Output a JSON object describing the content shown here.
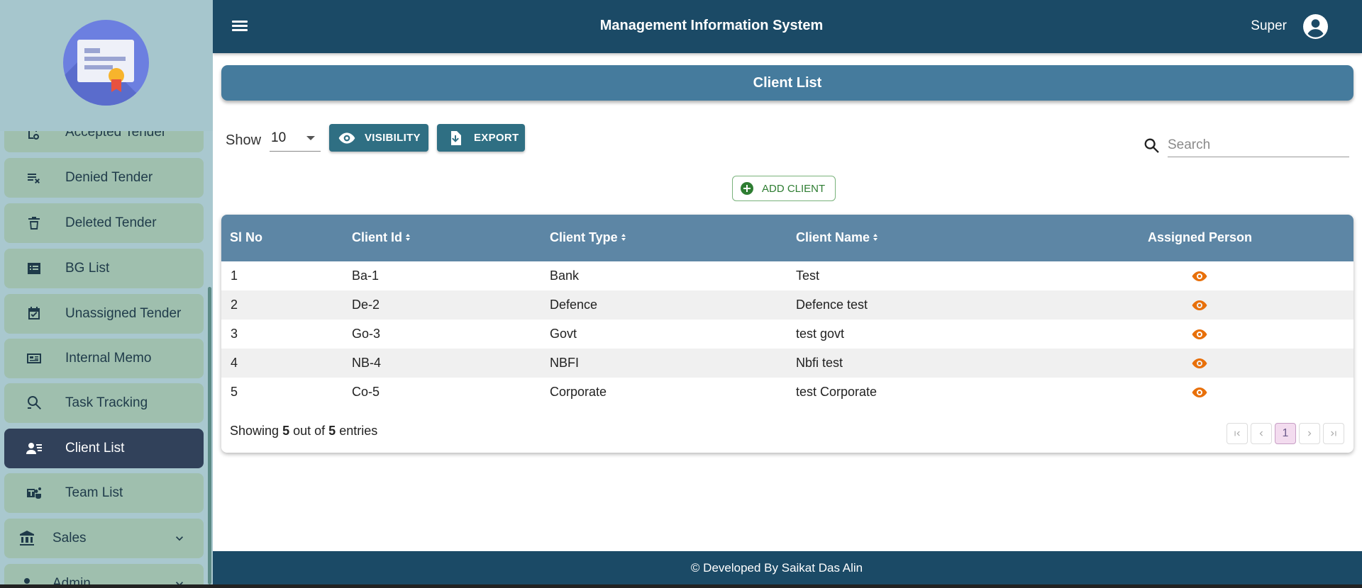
{
  "header": {
    "title": "Management Information System",
    "user_name": "Super"
  },
  "sidebar": {
    "items": [
      {
        "label": "Accepted Tender",
        "icon": "tender-accepted-icon"
      },
      {
        "label": "Denied Tender",
        "icon": "playlist-remove-icon"
      },
      {
        "label": "Deleted Tender",
        "icon": "trash-icon"
      },
      {
        "label": "BG List",
        "icon": "list-icon"
      },
      {
        "label": "Unassigned Tender",
        "icon": "calendar-check-icon"
      },
      {
        "label": "Internal Memo",
        "icon": "memo-icon"
      },
      {
        "label": "Task Tracking",
        "icon": "task-tracking-icon"
      },
      {
        "label": "Client List",
        "icon": "client-list-icon",
        "active": true
      },
      {
        "label": "Team List",
        "icon": "teams-icon"
      }
    ],
    "groups": [
      {
        "label": "Sales",
        "icon": "bank-icon"
      },
      {
        "label": "Admin",
        "icon": "admin-icon"
      }
    ]
  },
  "page": {
    "title": "Client List"
  },
  "toolbar": {
    "show_label": "Show",
    "page_size": "10",
    "visibility_label": "VISIBILITY",
    "export_label": "EXPORT",
    "search_placeholder": "Search",
    "add_client_label": "ADD CLIENT"
  },
  "table": {
    "columns": [
      "Sl No",
      "Client Id",
      "Client Type",
      "Client Name",
      "Assigned Person"
    ],
    "rows": [
      {
        "sl": "1",
        "id": "Ba-1",
        "type": "Bank",
        "name": "Test"
      },
      {
        "sl": "2",
        "id": "De-2",
        "type": "Defence",
        "name": "Defence test"
      },
      {
        "sl": "3",
        "id": "Go-3",
        "type": "Govt",
        "name": "test govt"
      },
      {
        "sl": "4",
        "id": "NB-4",
        "type": "NBFI",
        "name": "Nbfi test"
      },
      {
        "sl": "5",
        "id": "Co-5",
        "type": "Corporate",
        "name": "test Corporate"
      }
    ],
    "footer": {
      "showing": "Showing",
      "shown_count": "5",
      "out_of": "out of",
      "total_count": "5",
      "entries": "entries"
    },
    "current_page": "1"
  },
  "footer": {
    "credit": "© Developed By Saikat Das Alin"
  },
  "colors": {
    "header_bg": "#1b4a66",
    "sidebar_bg": "#a9c8cf",
    "menu_item_bg": "#9fbfae",
    "menu_item_active_bg": "#31415a",
    "page_header_bg": "#457b9d",
    "table_head_bg": "#5d86a5",
    "action_button_bg": "#2f6f83",
    "add_client_green": "#2e7d32",
    "eye_icon_orange": "#e8700a"
  }
}
